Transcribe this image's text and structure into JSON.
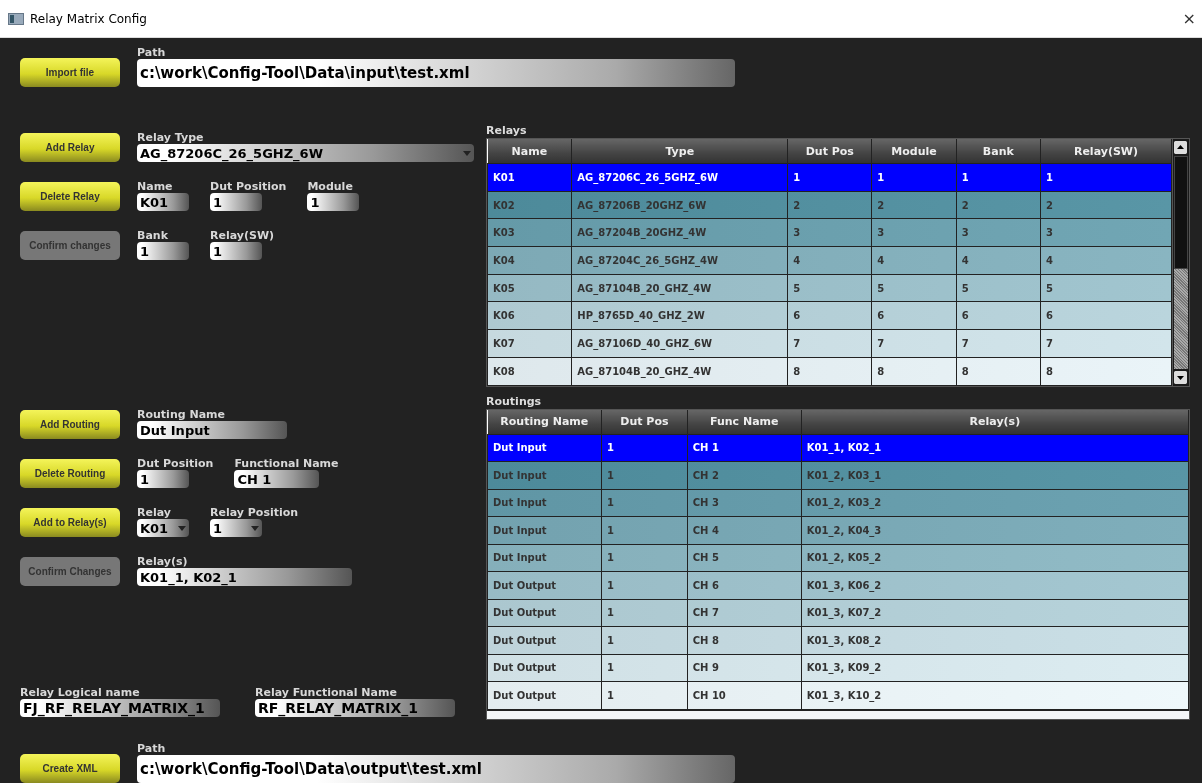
{
  "window": {
    "title": "Relay Matrix Config",
    "close": "×"
  },
  "import": {
    "button": {
      "label": "Import file",
      "disabled": false
    },
    "path_label": "Path",
    "path": "c:\\work\\Config-Tool\\Data\\input\\test.xml"
  },
  "relay_form": [
    {
      "button": {
        "label": "Add Relay",
        "disabled": false
      },
      "fields": [
        {
          "label": "Relay Type",
          "value": "AG_87206C_26_5GHZ_6W",
          "kind": "combo"
        }
      ]
    },
    {
      "button": {
        "label": "Delete Relay",
        "disabled": false
      },
      "fields": [
        {
          "label": "Name",
          "value": "K01",
          "kind": "text"
        },
        {
          "label": "Dut Position",
          "value": "1",
          "kind": "text"
        },
        {
          "label": "Module",
          "value": "1",
          "kind": "text"
        }
      ]
    },
    {
      "button": {
        "label": "Confirm changes",
        "disabled": true
      },
      "fields": [
        {
          "label": "Bank",
          "value": "1",
          "kind": "text"
        },
        {
          "label": "Relay(SW)",
          "value": "1",
          "kind": "text"
        }
      ]
    }
  ],
  "routing_form": [
    {
      "button": {
        "label": "Add Routing",
        "disabled": false
      },
      "fields": [
        {
          "label": "Routing Name",
          "value": "Dut Input",
          "kind": "text"
        }
      ]
    },
    {
      "button": {
        "label": "Delete Routing",
        "disabled": false
      },
      "fields": [
        {
          "label": "Dut Position",
          "value": "1",
          "kind": "text"
        },
        {
          "label": "Functional Name",
          "value": "CH 1",
          "kind": "text"
        }
      ]
    },
    {
      "button": {
        "label": "Add to Relay(s)",
        "disabled": false
      },
      "fields": [
        {
          "label": "Relay",
          "value": "K01",
          "kind": "dropdown"
        },
        {
          "label": "Relay Position",
          "value": "1",
          "kind": "dropdown"
        }
      ]
    },
    {
      "button": {
        "label": "Confirm Changes",
        "disabled": true
      },
      "fields": [
        {
          "label": "Relay(s)",
          "value": "K01_1, K02_1",
          "kind": "text"
        }
      ]
    }
  ],
  "names": [
    {
      "label": "Relay Logical name",
      "value": "FJ_RF_RELAY_MATRIX_1"
    },
    {
      "label": "Relay Functional Name",
      "value": "RF_RELAY_MATRIX_1"
    }
  ],
  "export": {
    "button": {
      "label": "Create XML",
      "disabled": false
    },
    "path_label": "Path",
    "path": "c:\\work\\Config-Tool\\Data\\output\\test.xml"
  },
  "relays": {
    "title": "Relays",
    "columns": [
      "Name",
      "Type",
      "Dut Pos",
      "Module",
      "Bank",
      "Relay(SW)"
    ],
    "rows": [
      {
        "cells": [
          "K01",
          "AG_87206C_26_5GHZ_6W",
          "1",
          "1",
          "1",
          "1"
        ],
        "selected": true
      },
      {
        "cells": [
          "K02",
          "AG_87206B_20GHZ_6W",
          "2",
          "2",
          "2",
          "2"
        ],
        "selected": false
      },
      {
        "cells": [
          "K03",
          "AG_87204B_20GHZ_4W",
          "3",
          "3",
          "3",
          "3"
        ],
        "selected": false
      },
      {
        "cells": [
          "K04",
          "AG_87204C_26_5GHZ_4W",
          "4",
          "4",
          "4",
          "4"
        ],
        "selected": false
      },
      {
        "cells": [
          "K05",
          "AG_87104B_20_GHZ_4W",
          "5",
          "5",
          "5",
          "5"
        ],
        "selected": false
      },
      {
        "cells": [
          "K06",
          "HP_8765D_40_GHZ_2W",
          "6",
          "6",
          "6",
          "6"
        ],
        "selected": false
      },
      {
        "cells": [
          "K07",
          "AG_87106D_40_GHZ_6W",
          "7",
          "7",
          "7",
          "7"
        ],
        "selected": false
      },
      {
        "cells": [
          "K08",
          "AG_87104B_20_GHZ_4W",
          "8",
          "8",
          "8",
          "8"
        ],
        "selected": false
      }
    ]
  },
  "routings": {
    "title": "Routings",
    "columns": [
      "Routing Name",
      "Dut Pos",
      "Func Name",
      "Relay(s)"
    ],
    "rows": [
      {
        "cells": [
          "Dut Input",
          "1",
          "CH 1",
          "K01_1, K02_1"
        ],
        "selected": true
      },
      {
        "cells": [
          "Dut Input",
          "1",
          "CH 2",
          "K01_2, K03_1"
        ],
        "selected": false
      },
      {
        "cells": [
          "Dut Input",
          "1",
          "CH 3",
          "K01_2, K03_2"
        ],
        "selected": false
      },
      {
        "cells": [
          "Dut Input",
          "1",
          "CH 4",
          "K01_2, K04_3"
        ],
        "selected": false
      },
      {
        "cells": [
          "Dut Input",
          "1",
          "CH 5",
          "K01_2, K05_2"
        ],
        "selected": false
      },
      {
        "cells": [
          "Dut Output",
          "1",
          "CH 6",
          "K01_3, K06_2"
        ],
        "selected": false
      },
      {
        "cells": [
          "Dut Output",
          "1",
          "CH 7",
          "K01_3, K07_2"
        ],
        "selected": false
      },
      {
        "cells": [
          "Dut Output",
          "1",
          "CH 8",
          "K01_3, K08_2"
        ],
        "selected": false
      },
      {
        "cells": [
          "Dut Output",
          "1",
          "CH 9",
          "K01_3, K09_2"
        ],
        "selected": false
      },
      {
        "cells": [
          "Dut Output",
          "1",
          "CH 10",
          "K01_3, K10_2"
        ],
        "selected": false
      }
    ]
  }
}
